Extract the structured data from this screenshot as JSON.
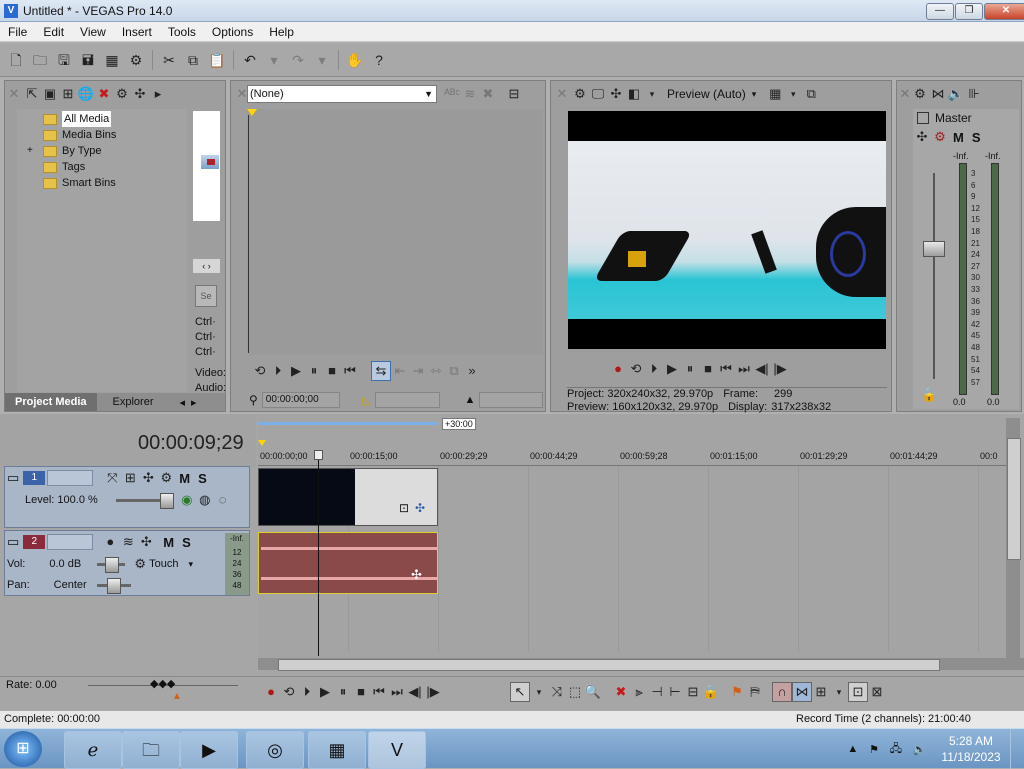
{
  "window": {
    "title": "Untitled * - VEGAS Pro 14.0",
    "min": "—",
    "max": "❐",
    "close": "✕"
  },
  "menu": [
    "File",
    "Edit",
    "View",
    "Insert",
    "Tools",
    "Options",
    "Help"
  ],
  "project_media": {
    "tree": [
      "All Media",
      "Media Bins",
      "By Type",
      "Tags",
      "Smart Bins"
    ],
    "expander": "+",
    "side_labels": [
      "Ctrl·",
      "Ctrl·",
      "Ctrl·",
      "Video:",
      "Audio:"
    ],
    "tabs": [
      "Project Media",
      "Explorer"
    ]
  },
  "trimmer": {
    "dropdown": "(None)",
    "timecode": "00:00:00;00"
  },
  "preview": {
    "mode": "Preview (Auto)",
    "project_label": "Project:",
    "project_value": "320x240x32, 29.970p",
    "frame_label": "Frame:",
    "frame_value": "299",
    "preview_label": "Preview:",
    "preview_value": "160x120x32, 29.970p",
    "display_label": "Display:",
    "display_value": "317x238x32"
  },
  "master": {
    "title": "Master",
    "m": "M",
    "s": "S",
    "inf_left": "-Inf.",
    "inf_right": "-Inf.",
    "scale": [
      "3",
      "6",
      "9",
      "12",
      "15",
      "18",
      "21",
      "24",
      "27",
      "30",
      "33",
      "36",
      "39",
      "42",
      "45",
      "48",
      "51",
      "54",
      "57"
    ],
    "bottom_left": "0.0",
    "bottom_right": "0.0"
  },
  "timeline": {
    "cursor_time": "00:00:09;29",
    "region_label": "+30:00",
    "ruler": [
      "00:00:00;00",
      "00:00:15;00",
      "00:00:29;29",
      "00:00:44;29",
      "00:00:59;28",
      "00:01:15;00",
      "00:01:29;29",
      "00:01:44;29",
      "00:0"
    ],
    "track1": {
      "number": "1",
      "level": "Level: 100.0 %",
      "m": "M",
      "s": "S"
    },
    "track2": {
      "number": "2",
      "vol_label": "Vol:",
      "vol_value": "0.0 dB",
      "pan_label": "Pan:",
      "pan_value": "Center",
      "mode": "Touch",
      "m": "M",
      "s": "S",
      "inf": "-Inf.",
      "scale": [
        "12",
        "24",
        "36",
        "48"
      ]
    },
    "rate": "Rate: 0.00"
  },
  "status": {
    "left": "Complete: 00:00:00",
    "right": "Record Time (2 channels): 21:00:40"
  },
  "taskbar": {
    "time": "5:28 AM",
    "date": "11/18/2023"
  }
}
